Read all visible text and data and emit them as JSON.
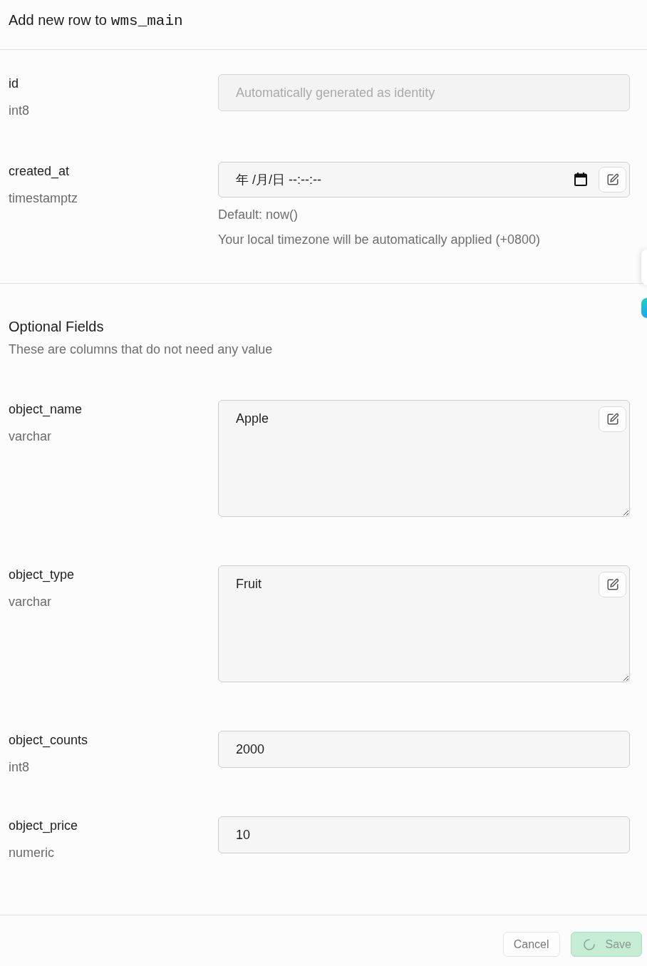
{
  "dialog": {
    "title": "Add new row to",
    "table_name": "wms_main"
  },
  "required_fields": [
    {
      "name": "id",
      "type": "int8",
      "kind": "identity",
      "placeholder": "Automatically generated as identity",
      "disabled": true
    },
    {
      "name": "created_at",
      "type": "timestamptz",
      "kind": "datetime",
      "placeholder": "年 /月/日 --:--:--",
      "hints": [
        "Default: now()",
        "Your local timezone will be automatically applied (+0800)"
      ]
    }
  ],
  "optional_section": {
    "title": "Optional Fields",
    "description": "These are columns that do not need any value"
  },
  "optional_fields": [
    {
      "name": "object_name",
      "type": "varchar",
      "kind": "textarea",
      "value": "Apple"
    },
    {
      "name": "object_type",
      "type": "varchar",
      "kind": "textarea",
      "value": "Fruit"
    },
    {
      "name": "object_counts",
      "type": "int8",
      "kind": "text",
      "value": "2000"
    },
    {
      "name": "object_price",
      "type": "numeric",
      "kind": "text",
      "value": "10"
    }
  ],
  "footer": {
    "buttons": [
      {
        "label": "Cancel",
        "kind": "secondary"
      },
      {
        "label": "Save",
        "kind": "primary",
        "loading": true
      }
    ]
  }
}
